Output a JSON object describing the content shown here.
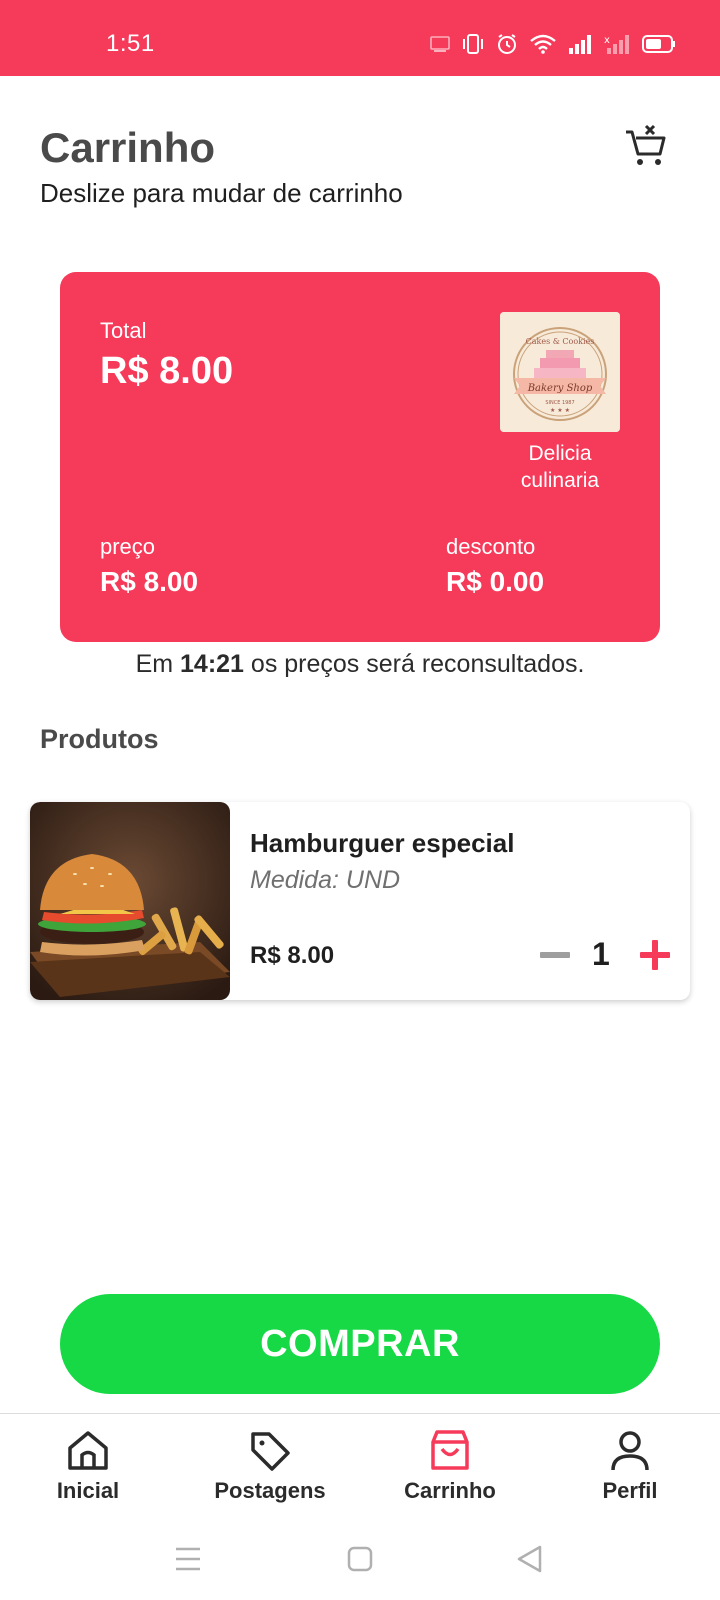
{
  "status_bar": {
    "time": "1:51",
    "icons": [
      "cast-icon",
      "vibrate-icon",
      "alarm-icon",
      "wifi-icon",
      "signal-icon",
      "signal-off-icon",
      "battery-icon"
    ]
  },
  "header": {
    "title": "Carrinho",
    "subtitle": "Deslize para mudar de carrinho"
  },
  "summary": {
    "total_label": "Total",
    "total_value": "R$ 8.00",
    "store_name": "Delicia culinaria",
    "logo_text": {
      "top": "Cakes & Cookies",
      "ribbon": "Bakery Shop",
      "bottom": "SINCE 1987"
    },
    "price_label": "preço",
    "price_value": "R$ 8.00",
    "discount_label": "desconto",
    "discount_value": "R$ 0.00"
  },
  "reconsult": {
    "prefix": "Em",
    "time": "14:21",
    "suffix": "os preços será reconsultados."
  },
  "products_section": {
    "title": "Produtos",
    "items": [
      {
        "name": "Hamburguer especial",
        "unit": "Medida: UND",
        "price": "R$ 8.00",
        "quantity": "1"
      }
    ]
  },
  "buy_button": {
    "label": "COMPRAR"
  },
  "bottom_nav": {
    "items": [
      {
        "label": "Inicial",
        "icon": "home-icon"
      },
      {
        "label": "Postagens",
        "icon": "tag-icon"
      },
      {
        "label": "Carrinho",
        "icon": "shopping-bag-icon",
        "active": true
      },
      {
        "label": "Perfil",
        "icon": "user-icon"
      }
    ]
  },
  "colors": {
    "primary": "#f53a5a",
    "buy": "#16d945",
    "text": "#1f1f1f"
  }
}
